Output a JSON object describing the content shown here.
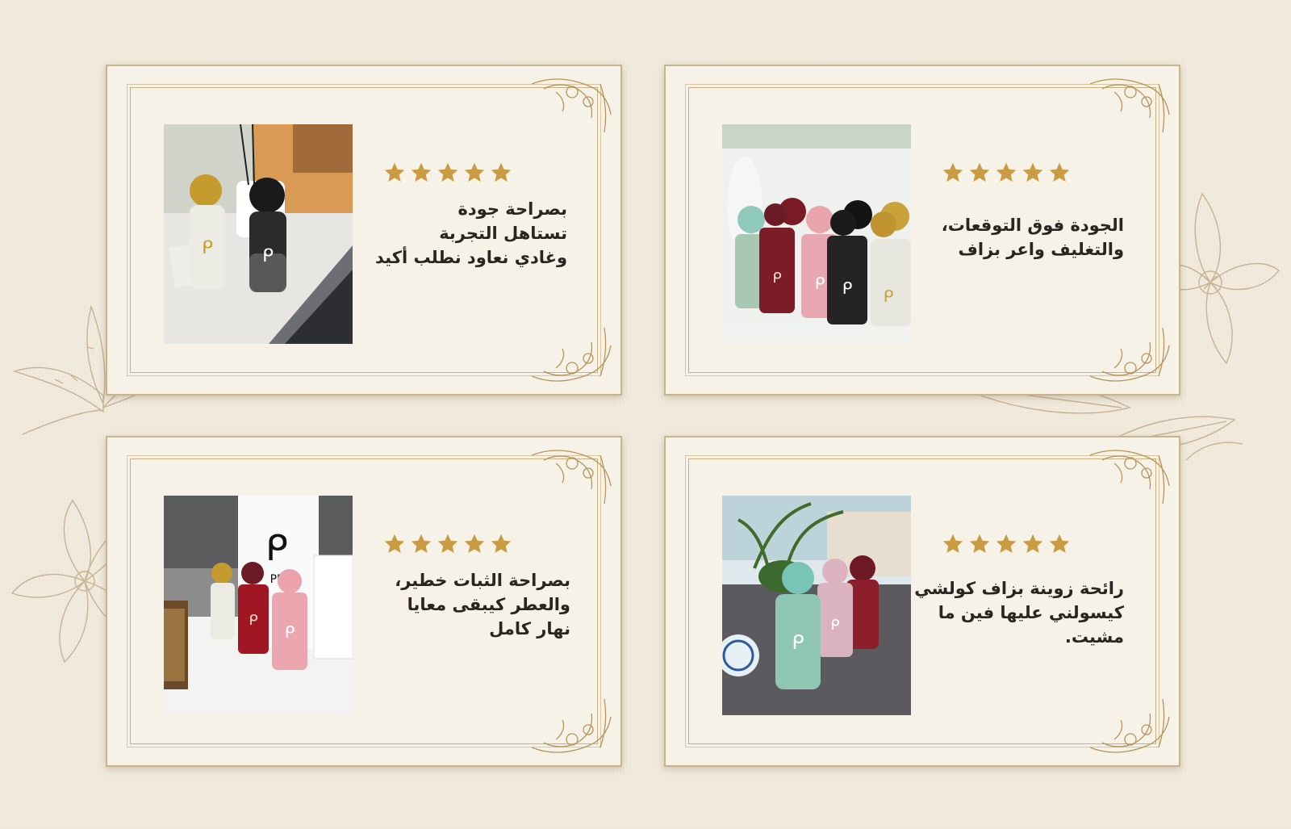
{
  "theme": {
    "page_background": "#f1ebdf",
    "card_background": "#f7f2e7",
    "frame_color": "#c7b183",
    "star_color": "#c99b42",
    "ornament_color": "#b5955a",
    "text_color": "#2a2520"
  },
  "reviews": [
    {
      "stars": 5,
      "text_lines": [
        "بصراحة جودة",
        "تستاهل التجربة",
        "وغادي نعاود نطلب أكيد"
      ],
      "icons": [
        "star-icon",
        "perfume-bottle-image",
        "laptop-image"
      ]
    },
    {
      "stars": 5,
      "text_lines": [
        "الجودة فوق التوقعات،",
        "والتغليف واعر بزاف"
      ],
      "icons": [
        "star-icon",
        "perfume-bottles-row-image"
      ]
    },
    {
      "stars": 5,
      "text_lines": [
        "بصراحة الثبات خطير،",
        "والعطر كيبقى معايا",
        "نهار كامل"
      ],
      "icons": [
        "star-icon",
        "perfume-gift-bag-image"
      ]
    },
    {
      "stars": 5,
      "text_lines": [
        "رائحة زوينة بزاف كولشي",
        "كيسولني عليها فين ما",
        "مشيت."
      ],
      "icons": [
        "star-icon",
        "perfume-bottles-table-image"
      ]
    }
  ]
}
